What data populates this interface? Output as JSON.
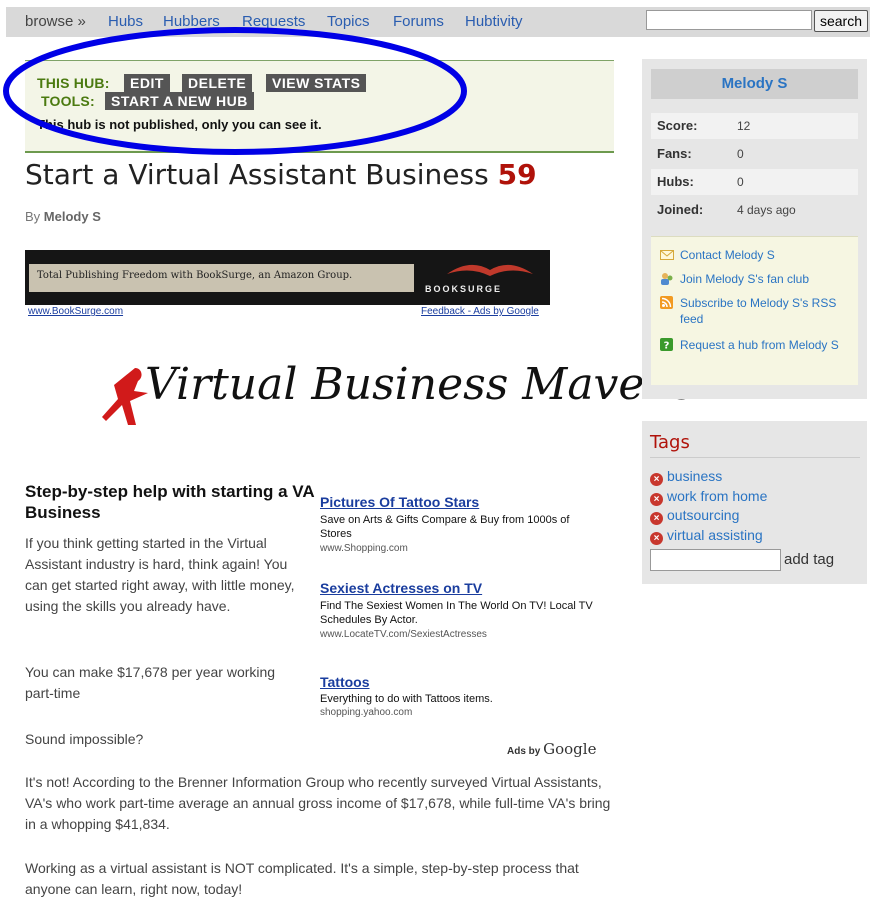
{
  "nav": {
    "browse": "browse »",
    "items": [
      "Hubs",
      "Hubbers",
      "Requests",
      "Topics",
      "Forums",
      "Hubtivity"
    ],
    "search_button": "search",
    "search_value": ""
  },
  "tools": {
    "label1": "THIS HUB:",
    "label2": "TOOLS:",
    "edit": "EDIT",
    "delete": "DELETE",
    "view_stats": "VIEW STATS",
    "start_new": "START A NEW HUB",
    "notice": "This hub is not published, only you can see it."
  },
  "article": {
    "title": "Start a Virtual Assistant Business",
    "score": "59",
    "by": "By",
    "author": "Melody S",
    "logo_text": "Virtual Business Mavens",
    "subhead": "Step-by-step help with starting a VA Business",
    "paragraphs": [
      "If you think getting started in the Virtual Assistant industry is hard, think again! You can get started right away, with little money, using the skills you already have.",
      "You can make $17,678 per year working part-time",
      "Sound impossible?",
      "It's not! According to the Brenner Information Group who recently surveyed Virtual Assistants, VA's who work part-time average an annual gross income of $17,678, while full-time VA's bring in a whopping $41,834.",
      "Working as a virtual assistant is NOT complicated. It's a simple, step-by-step process that anyone can learn, right now, today!"
    ]
  },
  "banner": {
    "strip_text": "Total Publishing Freedom with BookSurge, an Amazon Group.",
    "brand": "BOOKSURGE",
    "left_link": "www.BookSurge.com",
    "right_link": "Feedback - Ads by Google"
  },
  "ads": [
    {
      "title": "Pictures Of Tattoo Stars",
      "text": "Save on Arts & Gifts Compare & Buy from 1000s of Stores",
      "url": "www.Shopping.com"
    },
    {
      "title": "Sexiest Actresses on TV",
      "text": "Find The Sexiest Women In The World On TV! Local TV Schedules By Actor.",
      "url": "www.LocateTV.com/SexiestActresses"
    },
    {
      "title": "Tattoos",
      "text": "Everything to do with Tattoos items.",
      "url": "shopping.yahoo.com"
    }
  ],
  "ads_by": {
    "prefix": "Ads by",
    "brand": "Google"
  },
  "profile": {
    "name": "Melody S",
    "stats": [
      {
        "label": "Score:",
        "value": "12"
      },
      {
        "label": "Fans:",
        "value": "0"
      },
      {
        "label": "Hubs:",
        "value": "0"
      },
      {
        "label": "Joined:",
        "value": "4 days ago"
      }
    ],
    "links": [
      {
        "icon": "envelope-icon",
        "text": "Contact Melody S"
      },
      {
        "icon": "fan-club-icon",
        "text": "Join Melody S's fan club"
      },
      {
        "icon": "rss-icon",
        "text": "Subscribe to Melody S's RSS feed"
      },
      {
        "icon": "question-icon",
        "text": "Request a hub from Melody S"
      }
    ]
  },
  "tags": {
    "heading": "Tags",
    "items": [
      "business",
      "work from home",
      "outsourcing",
      "virtual assisting"
    ],
    "add_label": "add tag",
    "input_value": ""
  },
  "colors": {
    "ellipse": "#0000e6",
    "score": "#b0120a",
    "link": "#2a74c3"
  }
}
